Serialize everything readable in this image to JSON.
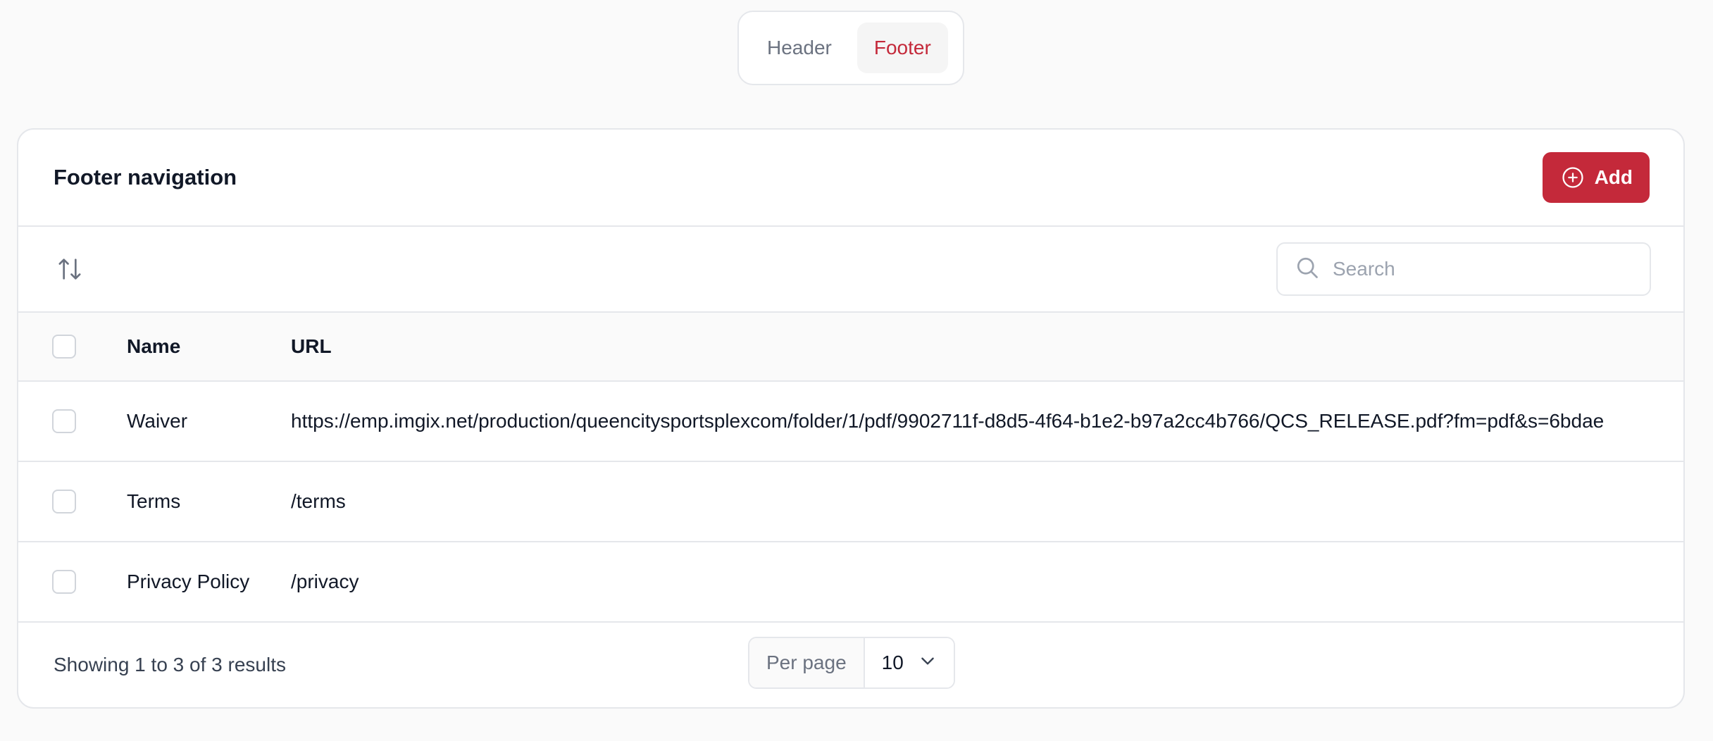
{
  "tabs": [
    {
      "label": "Header",
      "active": false
    },
    {
      "label": "Footer",
      "active": true
    }
  ],
  "card": {
    "title": "Footer navigation",
    "add_label": "Add"
  },
  "toolbar": {
    "search_placeholder": "Search"
  },
  "table": {
    "columns": [
      "Name",
      "URL"
    ],
    "rows": [
      {
        "name": "Waiver",
        "url": "https://emp.imgix.net/production/queencitysportsplexcom/folder/1/pdf/9902711f-d8d5-4f64-b1e2-b97a2cc4b766/QCS_RELEASE.pdf?fm=pdf&s=6bdae"
      },
      {
        "name": "Terms",
        "url": "/terms"
      },
      {
        "name": "Privacy Policy",
        "url": "/privacy"
      }
    ]
  },
  "footer": {
    "results_text": "Showing 1 to 3 of 3 results",
    "per_page_label": "Per page",
    "per_page_value": "10"
  },
  "colors": {
    "accent": "#c4293a",
    "border": "#e5e7eb",
    "muted_text": "#6b7280"
  },
  "icons": {
    "add": "plus-circle-icon",
    "sort": "arrows-up-down-icon",
    "search": "search-icon",
    "dropdown": "chevron-down-icon"
  }
}
